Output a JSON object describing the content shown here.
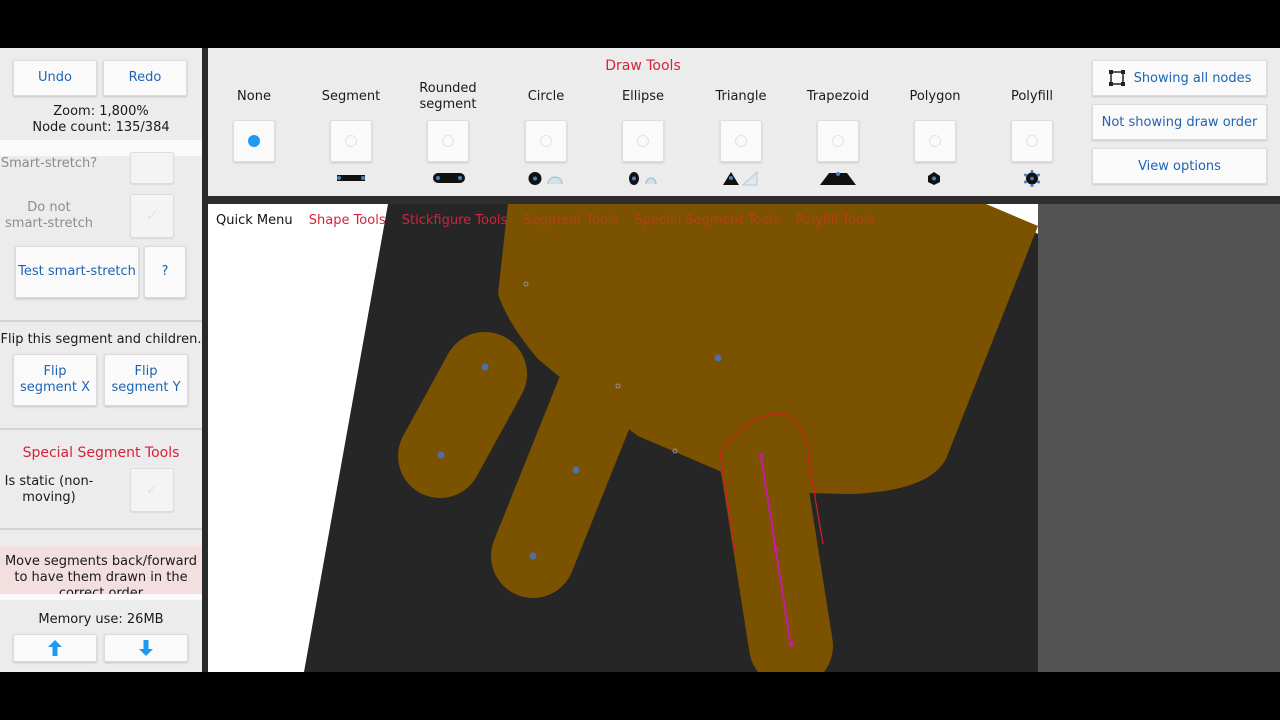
{
  "left_panel": {
    "undo": "Undo",
    "redo": "Redo",
    "zoom": "Zoom: 1,800%",
    "node_count": "Node count: 135/384",
    "smart_stretch_partial": "Smart-stretch?",
    "do_not_smart_stretch": "Do not smart-stretch",
    "test_smart_stretch": "Test smart-stretch",
    "help": "?",
    "flip_info": "Flip this segment and children.",
    "flip_x": "Flip segment X",
    "flip_y": "Flip segment Y",
    "special_header": "Special Segment Tools",
    "is_static": "Is static (non-moving)",
    "move_info": "Move segments back/forward to have them drawn in the correct order",
    "memory": "Memory use: 26MB"
  },
  "toolbar": {
    "title": "Draw Tools",
    "tools": [
      {
        "label": "None",
        "selected": true
      },
      {
        "label": "Segment",
        "selected": false
      },
      {
        "label": "Rounded segment",
        "selected": false
      },
      {
        "label": "Circle",
        "selected": false
      },
      {
        "label": "Ellipse",
        "selected": false
      },
      {
        "label": "Triangle",
        "selected": false
      },
      {
        "label": "Trapezoid",
        "selected": false
      },
      {
        "label": "Polygon",
        "selected": false
      },
      {
        "label": "Polyfill",
        "selected": false
      }
    ]
  },
  "right_buttons": {
    "showing_all_nodes": "Showing all nodes",
    "not_showing_draw_order": "Not showing draw order",
    "view_options": "View options"
  },
  "quick_menu": {
    "label": "Quick Menu",
    "items": [
      "Shape Tools",
      "Stickfigure Tools",
      "Segment Tools",
      "Special Segment Tools",
      "Polyfill Tools"
    ]
  },
  "colors": {
    "accent_blue": "#1f64b4",
    "accent_red": "#d6223a",
    "selected_radio": "#1e9af0",
    "shape_fill": "#7a5200",
    "canvas_dark": "#262626"
  }
}
